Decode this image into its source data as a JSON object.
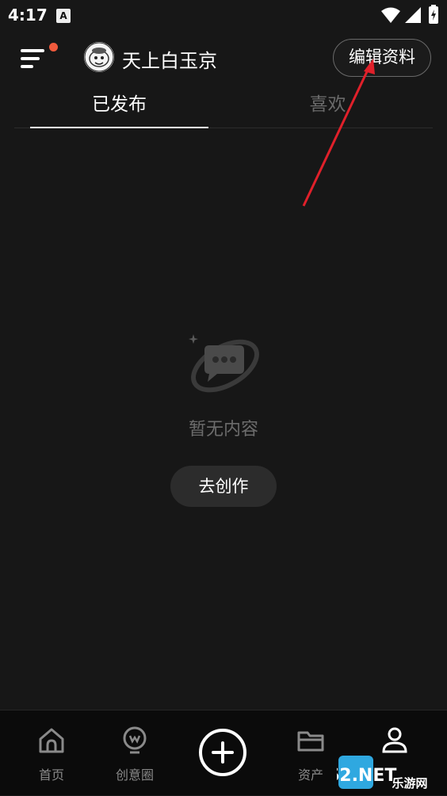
{
  "status_bar": {
    "time": "4:17",
    "notification_icon_text": "A"
  },
  "header": {
    "username": "天上白玉京",
    "edit_profile_label": "编辑资料"
  },
  "tabs": [
    {
      "label": "已发布",
      "active": true
    },
    {
      "label": "喜欢",
      "active": false
    }
  ],
  "empty_state": {
    "message": "暂无内容",
    "action_label": "去创作"
  },
  "bottom_nav": {
    "items": [
      {
        "label": "首页",
        "icon": "home-icon"
      },
      {
        "label": "创意圈",
        "icon": "bulb-icon"
      },
      {
        "label": "",
        "icon": "plus-circle-icon"
      },
      {
        "label": "资产",
        "icon": "folder-icon"
      },
      {
        "label": "",
        "icon": "person-icon"
      }
    ]
  },
  "watermark": {
    "text_top": "962.NET",
    "text_bottom": "乐游网"
  },
  "colors": {
    "background": "#171717",
    "notification_dot": "#f05a3c",
    "annotation_arrow": "#e0202a",
    "nav_background": "#0b0b0b"
  }
}
